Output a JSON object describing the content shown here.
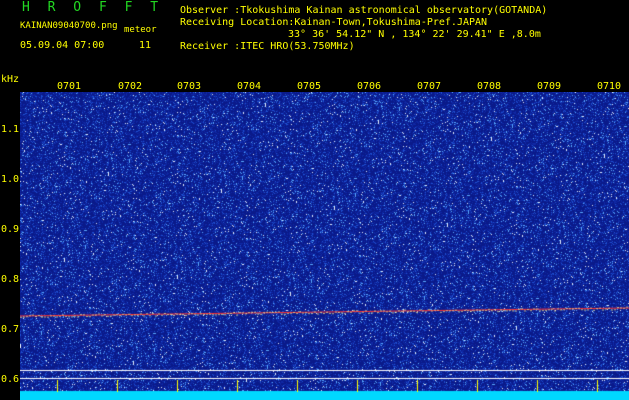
{
  "header": {
    "app_title": "H R O F F T",
    "filename": "KAINAN09040700.png",
    "meteor_label": "meteor",
    "date_time": "05.09.04 07:00",
    "meteor_count": "11",
    "observer_line": "Observer          :Tkokushima Kainan astronomical observatory(GOTANDA)",
    "location_line": "Receiving Location:Kainan-Town,Tokushima-Pref.JAPAN",
    "coords_line": "33° 36' 54.12\" N , 134° 22' 29.41\" E ,8.0m",
    "receiver_line": "Receiver          :ITEC HRO(53.750MHz)"
  },
  "axis": {
    "unit": "kHz",
    "y_ticks": [
      "1.1",
      "1.0",
      "0.9",
      "0.8",
      "0.7",
      "0.6"
    ],
    "time_ticks": [
      "0701",
      "0702",
      "0703",
      "0704",
      "0705",
      "0706",
      "0707",
      "0708",
      "0709",
      "0710"
    ]
  },
  "colors": {
    "background": "#000000",
    "label": "#ffff00",
    "title": "#22d822",
    "noise_base": "#0a1a8a",
    "signal_line": "#ff3030"
  }
}
